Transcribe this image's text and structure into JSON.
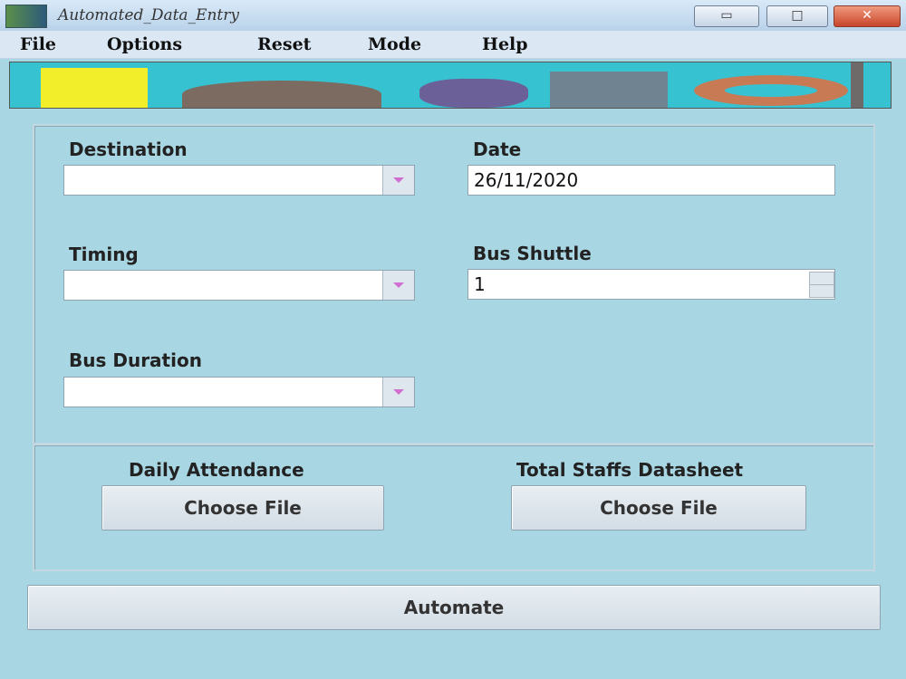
{
  "window": {
    "title": "Automated_Data_Entry",
    "buttons": {
      "minimize": "▭",
      "maximize": "□",
      "close": "✕"
    }
  },
  "menu": [
    "File",
    "Options",
    "Reset",
    "Mode",
    "Help"
  ],
  "banner": {
    "icon": "banner-logo",
    "colors": [
      "#f2ee2a",
      "#7b6b60",
      "#6b6098",
      "#6f8490",
      "#c87a55",
      "#37c2d2"
    ]
  },
  "form": {
    "destination": {
      "label": "Destination",
      "value": ""
    },
    "date": {
      "label": "Date",
      "value": "26/11/2020"
    },
    "timing": {
      "label": "Timing",
      "value": ""
    },
    "bus_shuttle": {
      "label": "Bus Shuttle",
      "value": "1"
    },
    "bus_duration": {
      "label": "Bus Duration",
      "value": ""
    }
  },
  "files": {
    "daily_attendance": {
      "label": "Daily Attendance",
      "button": "Choose File"
    },
    "total_staffs": {
      "label": "Total Staffs Datasheet",
      "button": "Choose File"
    }
  },
  "automate_label": "Automate",
  "colors": {
    "background": "#a9d6e3",
    "combo_arrow": "#d06fd0"
  }
}
